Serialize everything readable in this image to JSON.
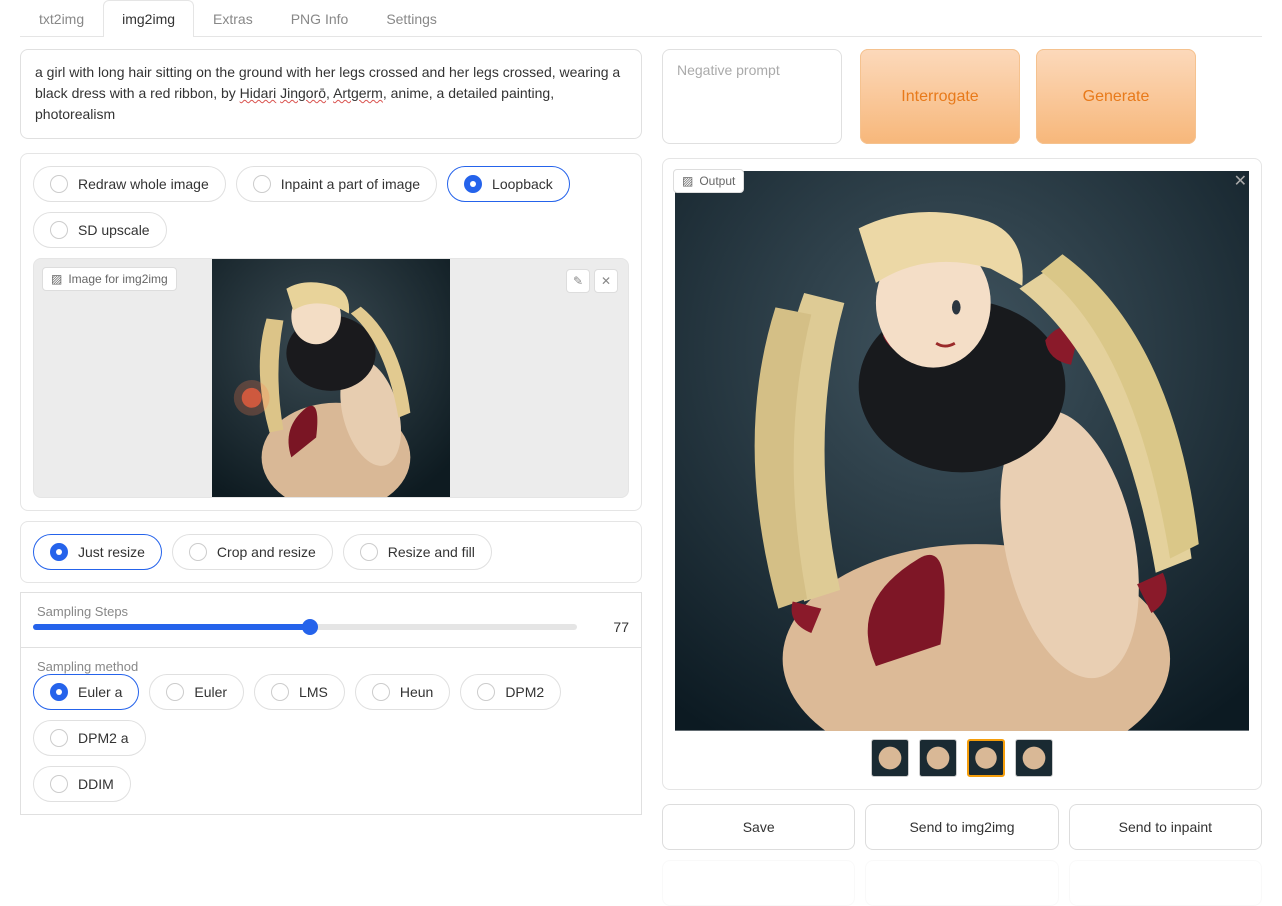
{
  "tabs": [
    "txt2img",
    "img2img",
    "Extras",
    "PNG Info",
    "Settings"
  ],
  "active_tab": 1,
  "prompt": {
    "pre": "a girl with long hair sitting on the ground with her legs crossed and her legs crossed, wearing a black dress with a red ribbon, by ",
    "w1": "Hidari",
    "gap1": " ",
    "w2": "Jingorō",
    "gap2": ", ",
    "w3": "Artgerm",
    "post": ", anime, a detailed painting, photorealism"
  },
  "negative_placeholder": "Negative prompt",
  "buttons": {
    "interrogate": "Interrogate",
    "generate": "Generate"
  },
  "mode_radios": [
    "Redraw whole image",
    "Inpaint a part of image",
    "Loopback",
    "SD upscale"
  ],
  "mode_selected": 2,
  "input_image_label": "Image for img2img",
  "resize_radios": [
    "Just resize",
    "Crop and resize",
    "Resize and fill"
  ],
  "resize_selected": 0,
  "sampling_steps": {
    "label": "Sampling Steps",
    "value": "77",
    "pct": 51
  },
  "sampling_method": {
    "label": "Sampling method",
    "options": [
      "Euler a",
      "Euler",
      "LMS",
      "Heun",
      "DPM2",
      "DPM2 a",
      "DDIM"
    ],
    "selected": 0
  },
  "output_label": "Output",
  "thumb_selected": 2,
  "output_buttons": [
    "Save",
    "Send to img2img",
    "Send to inpaint"
  ]
}
